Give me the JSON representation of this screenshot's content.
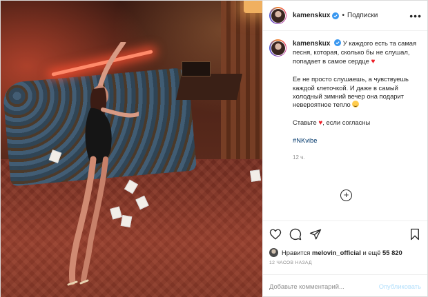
{
  "header": {
    "username": "kamenskux",
    "separator": "•",
    "follow_label": "Подписки",
    "more_icon": "more-horizontal-icon"
  },
  "caption": {
    "username": "kamenskux",
    "line1": "У каждого есть та самая песня, которая, сколько бы не слушал, попадает в самое сердце",
    "para2": "Ее не просто слушаешь, а чувствуешь каждой клеточкой. И даже в самый холодный зимний вечер она подарит невероятное тепло",
    "para3_prefix": "Ставьте",
    "para3_suffix": ", если согласны",
    "hashtag": "#NKvibe",
    "time": "12 ч.",
    "heart_glyph": "♥",
    "heart_color": "#ed1c24"
  },
  "load_more": "+",
  "actions": {
    "like_icon": "heart-outline-icon",
    "comment_icon": "comment-icon",
    "share_icon": "share-icon",
    "save_icon": "bookmark-icon"
  },
  "likes": {
    "prefix": "Нравится",
    "user": "melovin_official",
    "middle": "и ещё",
    "count": "55 820"
  },
  "posted_ago": "12 ЧАСОВ НАЗАД",
  "comment": {
    "placeholder": "Добавьте комментарий...",
    "publish_label": "Опубликовать"
  },
  "colors": {
    "verified": "#3897f0",
    "link": "#00376b",
    "publish_disabled": "#b2dffc",
    "muted": "#8e8e8e"
  }
}
